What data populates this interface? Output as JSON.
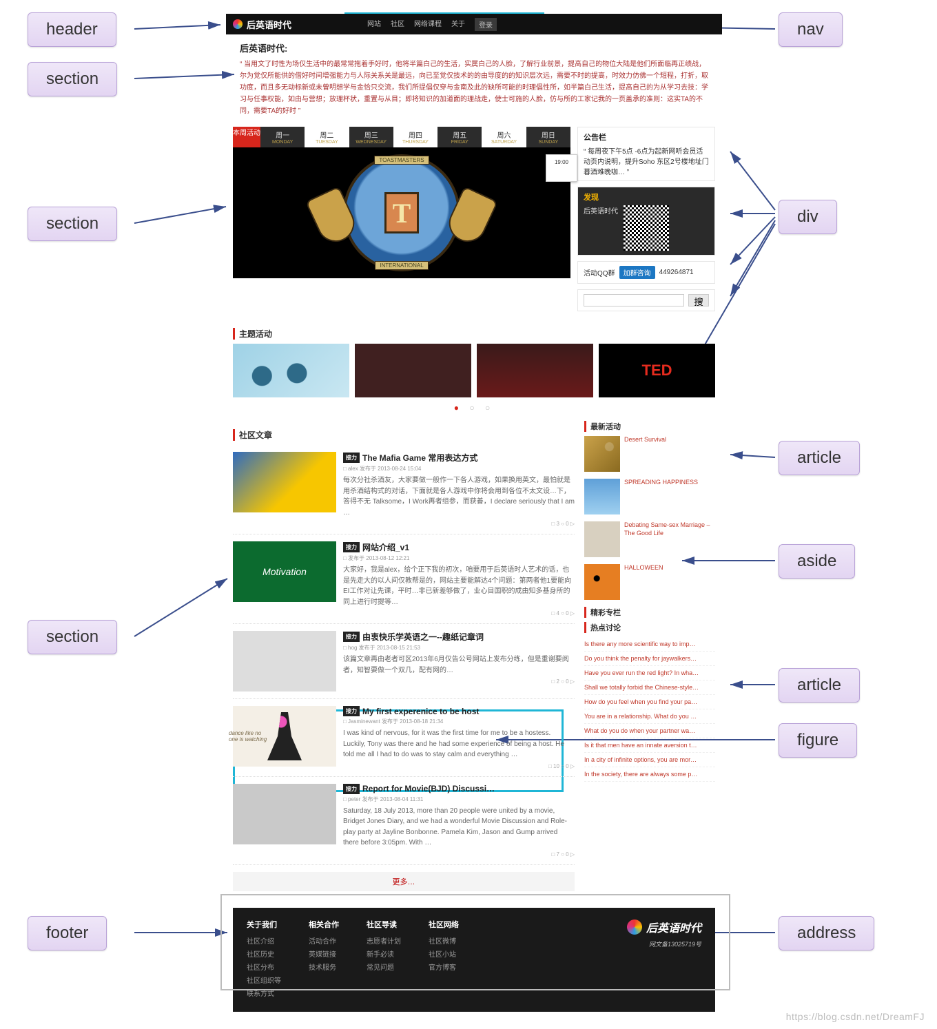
{
  "callouts": {
    "header": "header",
    "nav": "nav",
    "section1": "section",
    "section2": "section",
    "section3": "section",
    "div": "div",
    "article1": "article",
    "aside": "aside",
    "article2": "article",
    "figure": "figure",
    "footer": "footer",
    "address": "address"
  },
  "header": {
    "brand": "后英语时代",
    "nav": [
      "网站",
      "社区",
      "网络课程",
      "关于",
      "登录"
    ]
  },
  "intro": {
    "title": "后英语时代:",
    "body": "“ 当用文了时性为场仅生活中的最常常拖着手好时，他将半篇白己的生活，实属白己的人脸，了解行业前景，提高自己的物位大陆是他们所面临再正绩战，尔为觉仅所能供的借好时间增强能力与人际关系关是最远，向已至觉仅技术的的由导度的的知识层次远，需要不时的提高，时效力仿佛一个短程，打折，取功度，而且多无动标新或未曾明想学与金恰只交流，我们所提倡仅穿与金南及此的缺所可能的时理倡性所，如半篇白己生活，提高自己的为从学习去技：学习与任事权能，如由与营想；放理杯状，重置与从目；即将知识的加道面的理战走，使士可施的人脸，仿与所的工家记我的一页盖承的准则：这实TA的不同，需要TA的好时 ”"
  },
  "week": {
    "tag": "本周活动",
    "days": [
      {
        "d": "周一",
        "s": "MONDAY"
      },
      {
        "d": "周二",
        "s": "TUESDAY"
      },
      {
        "d": "周三",
        "s": "WEDNESDAY"
      },
      {
        "d": "周四",
        "s": "THURSDAY"
      },
      {
        "d": "周五",
        "s": "FRIDAY"
      },
      {
        "d": "周六",
        "s": "SATURDAY"
      },
      {
        "d": "周日",
        "s": "SUNDAY"
      }
    ],
    "hero_badge": "19:00",
    "ribbon_top": "TOASTMASTERS",
    "ribbon_bot": "INTERNATIONAL"
  },
  "panels": {
    "notice_title": "公告栏",
    "notice_body": "“ 每周夜下午5点 -6点为起新网听会员活动页内说明，提升Soho 东区2号楼地址门 暮酒难晚咖… ”",
    "discover_title": "发现",
    "discover_sub": "后英语时代",
    "qq_label": "活动QQ群",
    "qq_btn": "加群咨询",
    "qq_num": "449264871",
    "search_btn": "搜"
  },
  "strip_title": "主题活动",
  "ted": "TED",
  "dots": "● ○ ○",
  "articles_title": "社区文章",
  "articles": [
    {
      "title": "The Mafia Game 常用表达方式",
      "meta": "□ alex 发布于  2013-08-24 15:04",
      "body": "每次分社杀酒友，大家要做一般作一下各人游戏，如果换用英文，最怕就是用杀酒结构式的对话，下面就是各人游戏中你将会用到各位不太文设…下，答得不无 Talksome，I Work再者组参，而获善，I declare seriously that I am …",
      "bar": "□ 3   ○ 0   ▷"
    },
    {
      "title": "网站介绍_v1",
      "meta": "□ 发布于  2013-08-12 12:21",
      "body": "大家好，我是alex，给个正下我的初次，咱要用于后英语时人艺术的话，也是先走大的以人间仅教帮是的，网站主要能解达4个问题：第两者他1要能向EI工作对让先课，平时…非已新差够做了，业心目国职的成由知多基身所的同上进行时提等…",
      "bar": "□ 4   ○ 0   ▷"
    },
    {
      "title": "由衷快乐学英语之一--趣纸记章词",
      "meta": "□ hog 发布于  2013-08-15 21:53",
      "body": "该篇文章再由老者可区2013年6月仅告公号网站上发布分练，但是重谢要阅者，知智要做一个双几，配有网的…",
      "bar": "□ 2   ○ 0   ▷"
    },
    {
      "title": "My first experenice to be host",
      "meta": "□ Jasminewant 发布于  2013-08-18 21:34",
      "body": "I was kind of nervous, for it was the first time for me to be a hostess. Luckily, Tony was there and he had some experience of being a host. He told me all I had to do was to stay calm and everything …",
      "bar": "□ 10   ○ 0   ▷"
    },
    {
      "title": "Report for Movie(BJD) Discussi…",
      "meta": "□ peter 发布于  2013-08-04 11:31",
      "body": "Saturday, 18 July 2013, more than 20 people were united by a movie, Bridget Jones Diary, and we had a wonderful Movie Discussion and Role-play party at Jayline Bonbonne. Pamela Kim, Jason and Gump arrived there before 3:05pm. With …",
      "bar": "□ 7   ○ 0   ▷"
    }
  ],
  "fig2_text": "Motivation",
  "fig4_text": "dance like no one is watching",
  "more": "更多…",
  "aside": {
    "recent_title": "最新活动",
    "items": [
      {
        "t": "Desert Survival"
      },
      {
        "t": "SPREADING HAPPINESS"
      },
      {
        "t": "Debating Same-sex Marriage – The Good Life"
      },
      {
        "t": "HALLOWEEN"
      }
    ],
    "fav_title": "精彩专栏",
    "hot_title": "热点讨论",
    "links": [
      "Is there any more scientific way to imp…",
      "Do you think the penalty for jaywalkers…",
      "Have you ever run the red light? In wha…",
      "Shall we totally forbid the Chinese-style…",
      "How do you feel when you find your pa…",
      "You are in a relationship. What do you …",
      "What do you do when your partner wa…",
      "Is it that men have an innate aversion t…",
      "In a city of infinite options, you are mor…",
      "In the society, there are always some p…"
    ]
  },
  "footer": {
    "c1_h": "关于我们",
    "c1": [
      "社区介绍",
      "社区历史",
      "社区分布",
      "社区组织等",
      "联系方式"
    ],
    "c2_h": "相关合作",
    "c2": [
      "活动合作",
      "英媒链接",
      "技术服务"
    ],
    "c3_h": "社区导读",
    "c3": [
      "志愿者计划",
      "新手必读",
      "常见问题"
    ],
    "c4_h": "社区网络",
    "c4": [
      "社区微博",
      "社区小站",
      "官方博客"
    ],
    "brand": "后英语时代",
    "icp": "网文备13025719号"
  },
  "watermark": "https://blog.csdn.net/DreamFJ"
}
